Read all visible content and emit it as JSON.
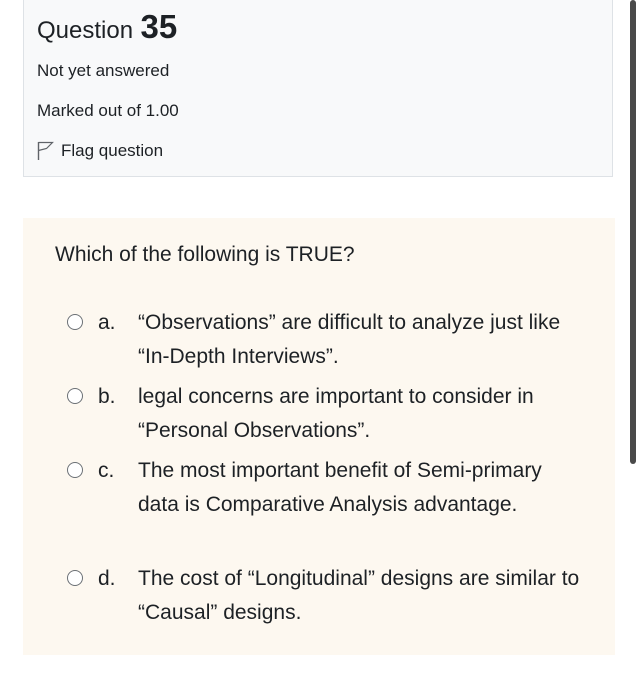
{
  "question_info": {
    "title_word": "Question",
    "number": "35",
    "state": "Not yet answered",
    "grade": "Marked out of 1.00",
    "flag_label": "Flag question"
  },
  "question": {
    "text": "Which of the following is TRUE?",
    "options": [
      {
        "letter": "a.",
        "text": "“Observations” are difficult to analyze just like “In-Depth Interviews”."
      },
      {
        "letter": "b.",
        "text": "legal concerns are important to consider in “Personal Observations”."
      },
      {
        "letter": "c.",
        "text": "The most important benefit of Semi-primary data is Comparative Analysis advantage."
      },
      {
        "letter": "d.",
        "text": "The cost of “Longitudinal” designs are similar to “Causal” designs."
      }
    ]
  }
}
